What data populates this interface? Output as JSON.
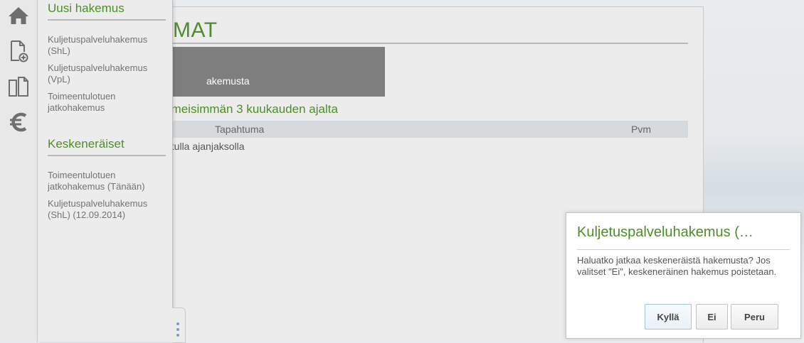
{
  "nav": {
    "icons": [
      "home-icon",
      "new-document-icon",
      "documents-icon",
      "euro-icon"
    ]
  },
  "main": {
    "title_fragment": "MAT",
    "tile_text_fragment": "akemusta",
    "events_heading_fragment": "iimeisimmän 3 kuukauden ajalta",
    "events_table": {
      "columns": [
        "Tapahtuma",
        "Pvm"
      ],
      "empty_text_fragment": "etulla ajanjaksolla"
    }
  },
  "flyout": {
    "new_application": {
      "heading": "Uusi hakemus",
      "items": [
        {
          "label": "Kuljetuspalveluhakemus (ShL)"
        },
        {
          "label": "Kuljetuspalveluhakemus (VpL)"
        },
        {
          "label": "Toimeentulotuen jatkohakemus"
        }
      ]
    },
    "in_progress": {
      "heading": "Keskeneräiset",
      "items": [
        {
          "label": "Toimeentulotuen jatkohakemus (Tänään)"
        },
        {
          "label": "Kuljetuspalveluhakemus (ShL) (12.09.2014)"
        }
      ]
    }
  },
  "dialog": {
    "title": "Kuljetuspalveluhakemus (…",
    "message": "Haluatko jatkaa keskeneräistä hakemusta? Jos valitset \"Ei\", keskeneräinen hakemus poistetaan.",
    "buttons": {
      "yes": "Kyllä",
      "no": "Ei",
      "cancel": "Peru"
    }
  },
  "colors": {
    "accent_green": "#4e8d2a",
    "tile_grey": "#7f7e7e",
    "handle_dots": "#7a9cc6"
  }
}
